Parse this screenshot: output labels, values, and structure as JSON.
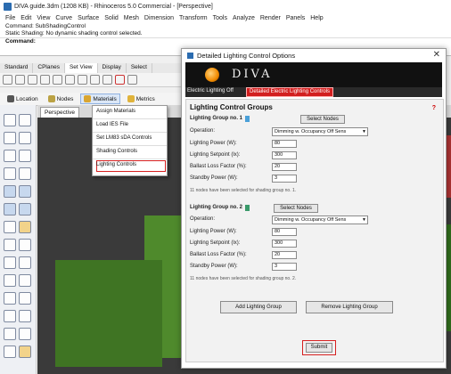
{
  "app": {
    "title": "DIVA guide.3dm (1208 KB) - Rhinoceros 5.0 Commercial - [Perspective]",
    "menu": [
      "File",
      "Edit",
      "View",
      "Curve",
      "Surface",
      "Solid",
      "Mesh",
      "Dimension",
      "Transform",
      "Tools",
      "Analyze",
      "Render",
      "Panels",
      "Help"
    ],
    "command_lines": [
      "Command: SubShadingControl",
      "Static Shading: No dynamic shading control selected."
    ],
    "command_prompt": "Command:",
    "toolbar_tabs": [
      "Standard",
      "CPlanes",
      "Set View",
      "Display",
      "Select"
    ],
    "panel_tabs": [
      "Location",
      "Nodes",
      "Materials",
      "Metrics"
    ],
    "viewport_label": "Perspective"
  },
  "menu": {
    "items": [
      "Assign Materials",
      "Load IES File",
      "Set LM83 sDA Controls",
      "Shading Controls",
      "Lighting Controls"
    ]
  },
  "dialog": {
    "title": "Detailed Lighting Control Options",
    "close": "✕",
    "logo_text": "DIVA",
    "tab_off": "Electric Lighting Off",
    "tab_detailed": "Detailed Electric Lighting Controls",
    "section_title": "Lighting Control Groups",
    "help": "?",
    "groups": [
      {
        "title": "Lighting Group no. 1",
        "swatch": "#4aa0d8",
        "select_label": "Select Nodes",
        "operation_label": "Operation:",
        "operation": "Dimming w. Occupancy Off Sens",
        "power_label": "Lighting Power (W):",
        "power": "80",
        "setpoint_label": "Lighting Setpoint (lx):",
        "setpoint": "300",
        "ballast_label": "Ballast Loss Factor (%):",
        "ballast": "20",
        "standby_label": "Standby Power (W):",
        "standby": "3",
        "note": "11 nodes have been selected for shading group no. 1."
      },
      {
        "title": "Lighting Group no. 2",
        "swatch": "#3a9a6a",
        "select_label": "Select Nodes",
        "operation_label": "Operation:",
        "operation": "Dimming w. Occupancy Off Sens",
        "power_label": "Lighting Power (W):",
        "power": "80",
        "setpoint_label": "Lighting Setpoint (lx):",
        "setpoint": "300",
        "ballast_label": "Ballast Loss Factor (%):",
        "ballast": "20",
        "standby_label": "Standby Power (W):",
        "standby": "3",
        "note": "11 nodes have been selected for shading group no. 2."
      }
    ],
    "add_group": "Add Lighting Group",
    "remove_group": "Remove Lighting Group",
    "submit": "Submit"
  },
  "colors": {
    "accent_red": "#d62020",
    "banner_bg": "#111111",
    "viewport_bg": "#3a3a3a",
    "model_green": "#4f8a2c"
  }
}
